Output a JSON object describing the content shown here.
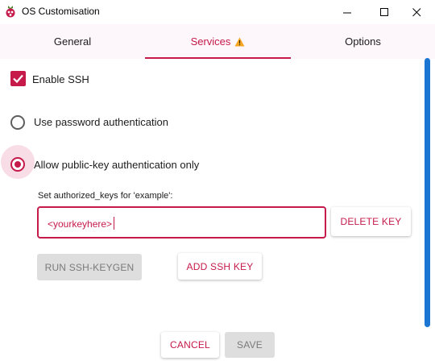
{
  "window": {
    "title": "OS Customisation"
  },
  "tabs": [
    {
      "label": "General"
    },
    {
      "label": "Services"
    },
    {
      "label": "Options"
    }
  ],
  "services": {
    "enable_ssh_label": "Enable SSH",
    "enable_ssh_checked": true,
    "password_auth_label": "Use password authentication",
    "pubkey_auth_label": "Allow public-key authentication only",
    "selected_auth": "pubkey",
    "authorized_keys_label": "Set authorized_keys for 'example':",
    "key_value": "<yourkeyhere>",
    "delete_key_label": "DELETE KEY",
    "run_keygen_label": "RUN SSH-KEYGEN",
    "add_key_label": "ADD SSH KEY"
  },
  "footer": {
    "cancel_label": "CANCEL",
    "save_label": "SAVE"
  },
  "colors": {
    "accent": "#c51a4a",
    "scrollbar": "#1a76d2",
    "tab_bg": "#fdf6fa"
  },
  "icons": [
    "raspberry-pi-icon",
    "minimize-icon",
    "maximize-icon",
    "close-icon",
    "warning-icon"
  ]
}
